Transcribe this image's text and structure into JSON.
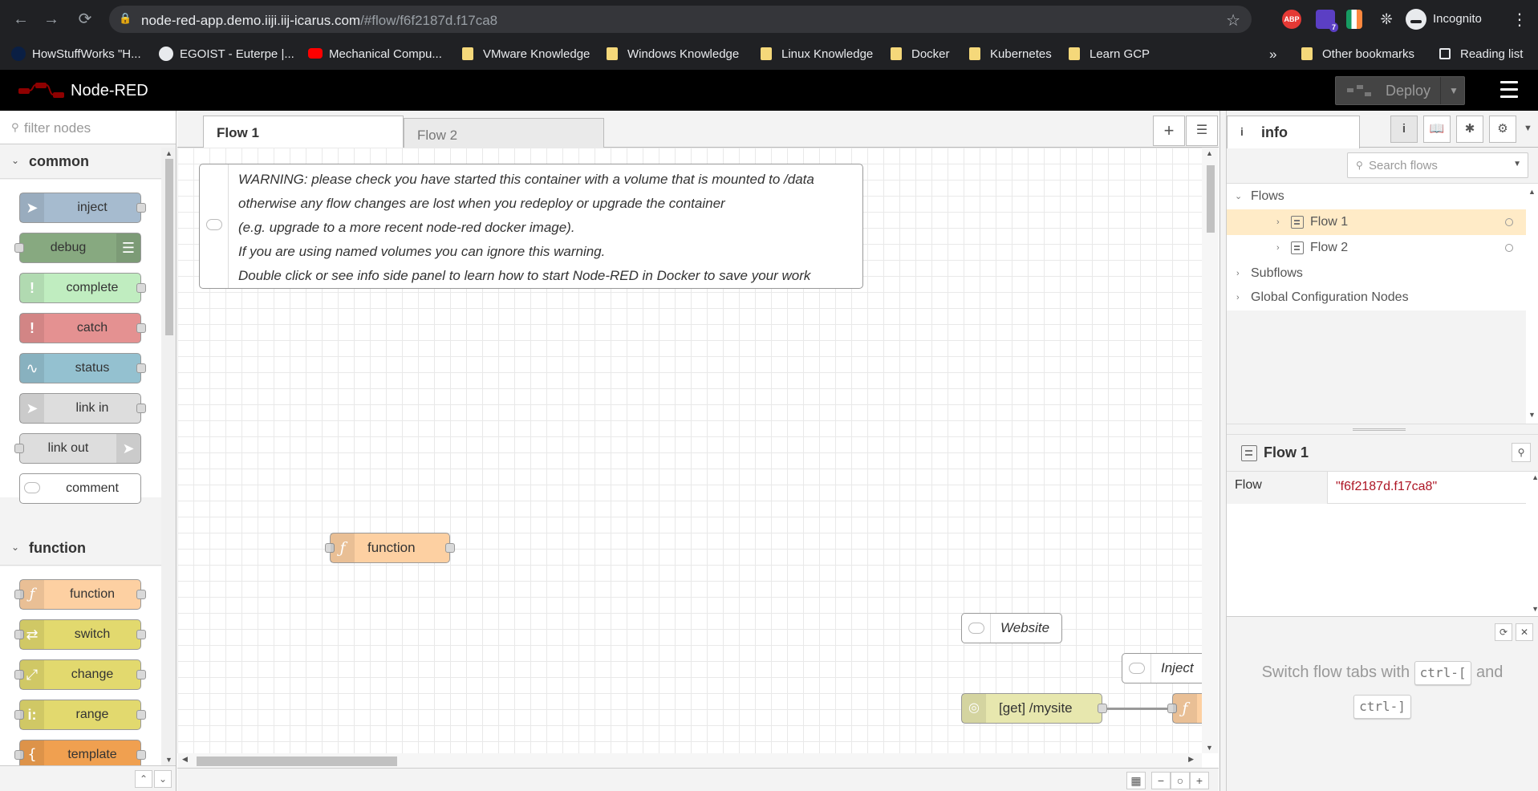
{
  "browser": {
    "url_host": "node-red-app.demo.iiji.iij-icarus.com",
    "url_path": "/#flow/f6f2187d.f17ca8",
    "ext_abp": "ABP",
    "ext_badge": "7",
    "profile": "Incognito",
    "bookmarks": [
      "HowStuffWorks \"H...",
      "EGOIST - Euterpe |...",
      "Mechanical Compu...",
      "VMware Knowledge",
      "Windows Knowledge",
      "Linux Knowledge",
      "Docker",
      "Kubernetes",
      "Learn GCP"
    ],
    "overflow": "»",
    "other_bookmarks": "Other bookmarks",
    "reading_list": "Reading list"
  },
  "header": {
    "title": "Node-RED",
    "deploy_label": "Deploy"
  },
  "palette": {
    "filter_placeholder": "filter nodes",
    "categories": [
      {
        "label": "common",
        "nodes": [
          "inject",
          "debug",
          "complete",
          "catch",
          "status",
          "link in",
          "link out",
          "comment"
        ]
      },
      {
        "label": "function",
        "nodes": [
          "function",
          "switch",
          "change",
          "range",
          "template"
        ]
      }
    ]
  },
  "workspace": {
    "tabs": [
      "Flow 1",
      "Flow 2"
    ],
    "warning_lines": [
      "WARNING: please check you have started this container with a volume that is mounted to /data",
      "otherwise any flow changes are lost when you redeploy or upgrade the container",
      "(e.g. upgrade to a more recent node-red docker image).",
      "If you are using named volumes you can ignore this warning.",
      "Double click or see info side panel to learn how to start Node-RED in Docker to save your work"
    ],
    "nodes": {
      "function": "function",
      "website_comment": "Website",
      "inject_comment": "Inject",
      "http_in": "[get] /mysite"
    }
  },
  "sidebar": {
    "tab_label": "info",
    "search_placeholder": "Search flows",
    "tree": {
      "flows": "Flows",
      "flow1": "Flow 1",
      "flow2": "Flow 2",
      "subflows": "Subflows",
      "global": "Global Configuration Nodes"
    },
    "props": {
      "title": "Flow 1",
      "key": "Flow",
      "value": "\"f6f2187d.f17ca8\""
    },
    "tip": {
      "text_a": "Switch flow tabs with",
      "key_a": "ctrl-[",
      "text_b": "and",
      "key_b": "ctrl-]"
    }
  },
  "colors": {
    "inject": "#a6bbcf",
    "debug": "#87a980",
    "complete": "#c0edc0",
    "catch": "#e49191",
    "status": "#94c1d0",
    "link": "#dddddd",
    "function": "#fdd0a2",
    "switch": "#e2d96e",
    "http": "#e7e7ae",
    "selected_row": "#ffebc7",
    "prop_value": "#AD1625"
  }
}
